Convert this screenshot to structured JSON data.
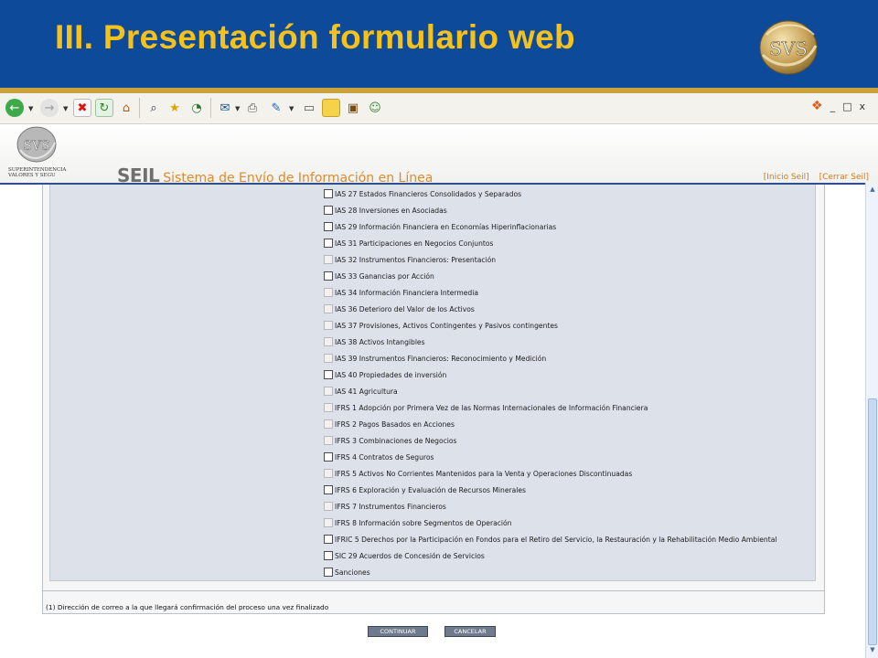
{
  "slide": {
    "title": "III. Presentación formulario web",
    "logo_text": "SVS",
    "brand_colors": {
      "header": "#0d4a9a",
      "title": "#f6c21a",
      "rule": "#c9a23c"
    }
  },
  "toolbar": {
    "icons": [
      "back-icon",
      "forward-icon",
      "stop-icon",
      "refresh-icon",
      "home-icon",
      "search-icon",
      "favorites-icon",
      "history-icon",
      "mail-icon",
      "print-icon",
      "edit-icon",
      "discuss-icon",
      "notes-icon",
      "research-icon",
      "messenger-icon"
    ],
    "window_controls": [
      "_",
      "□",
      "x"
    ]
  },
  "app": {
    "logo_text": "SVS",
    "org_line1": "SUPERINTENDENCIA",
    "org_line2": "VALORES Y SEGU",
    "seil": "SEIL",
    "subtitle": "Sistema de Envío de Información en Línea",
    "links": [
      "[Inicio Seil]",
      "[Cerrar Seil]"
    ]
  },
  "form": {
    "items": [
      {
        "label": "IAS 27 Estados Financieros Consolidados y Separados",
        "enabled": true
      },
      {
        "label": "IAS 28 Inversiones en Asociadas",
        "enabled": true
      },
      {
        "label": "IAS 29 Información Financiera en Economías Hiperinflacionarias",
        "enabled": true
      },
      {
        "label": "IAS 31 Participaciones en Negocios Conjuntos",
        "enabled": true
      },
      {
        "label": "IAS 32 Instrumentos Financieros: Presentación",
        "enabled": false
      },
      {
        "label": "IAS 33 Ganancias por Acción",
        "enabled": true
      },
      {
        "label": "IAS 34 Información Financiera Intermedia",
        "enabled": false
      },
      {
        "label": "IAS 36 Deterioro del Valor de los Activos",
        "enabled": false
      },
      {
        "label": "IAS 37 Provisiones, Activos Contingentes y Pasivos contingentes",
        "enabled": false
      },
      {
        "label": "IAS 38 Activos Intangibles",
        "enabled": false
      },
      {
        "label": "IAS 39 Instrumentos Financieros: Reconocimiento y Medición",
        "enabled": false
      },
      {
        "label": " IAS 40 Propiedades de inversión",
        "enabled": true
      },
      {
        "label": "IAS 41 Agricultura",
        "enabled": false
      },
      {
        "label": "IFRS 1 Adopción por Primera Vez de las Normas Internacionales de Información Financiera",
        "enabled": false
      },
      {
        "label": "IFRS 2 Pagos Basados en Acciones",
        "enabled": false
      },
      {
        "label": "IFRS 3 Combinaciones de Negocios",
        "enabled": false
      },
      {
        "label": "IFRS 4 Contratos de Seguros",
        "enabled": true
      },
      {
        "label": "IFRS 5 Activos No Corrientes Mantenidos para la Venta y Operaciones Discontinuadas",
        "enabled": false
      },
      {
        "label": "IFRS 6 Exploración y Evaluación de Recursos Minerales",
        "enabled": true
      },
      {
        "label": "IFRS 7 Instrumentos Financieros",
        "enabled": false
      },
      {
        "label": "IFRS 8 Información sobre Segmentos de Operación",
        "enabled": false
      },
      {
        "label": "IFRIC 5 Derechos por la Participación en Fondos para el Retiro del Servicio, la Restauración y la Rehabilitación Medio Ambiental",
        "enabled": true
      },
      {
        "label": "SIC 29 Acuerdos de Concesión de Servicios",
        "enabled": true
      },
      {
        "label": "Sanciones",
        "enabled": true
      }
    ],
    "footnote": "(1) Dirección de correo a la que llegará confirmación del proceso una vez finalizado",
    "continue_label": "CONTINUAR",
    "cancel_label": "CANCELAR"
  }
}
